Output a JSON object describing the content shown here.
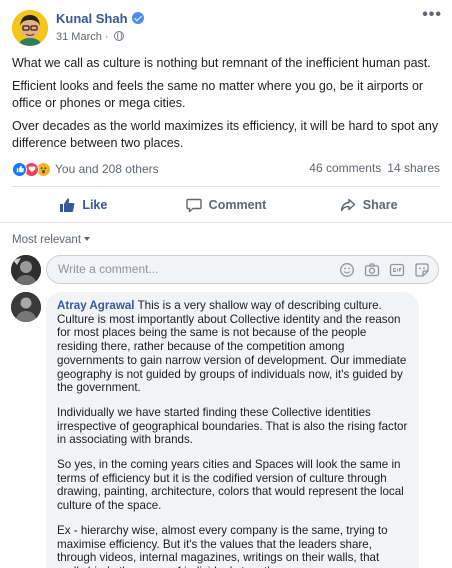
{
  "post": {
    "author": "Kunal Shah",
    "date": "31 March",
    "separator": "·",
    "more": "•••",
    "paragraphs": [
      "What we call as culture is nothing but remnant of the inefficient human past.",
      "Efficient looks and feels the same no matter where you go, be it airports or office or phones or mega cities.",
      "Over decades as the world maximizes its efficiency, it will be hard to spot any difference between two places."
    ],
    "reactions_text": "You and 208 others",
    "comments_count": "46 comments",
    "shares_count": "14 shares",
    "reaction_icons": [
      "like-icon",
      "love-icon",
      "wow-icon"
    ]
  },
  "actions": {
    "like": "Like",
    "comment": "Comment",
    "share": "Share"
  },
  "comments_filter": "Most relevant",
  "comment_input": {
    "placeholder": "Write a comment...",
    "icons": [
      "emoji-icon",
      "camera-icon",
      "gif-icon",
      "sticker-icon"
    ]
  },
  "comment": {
    "author": "Atray Agrawal",
    "paragraphs": [
      "This is a very shallow way of describing culture. Culture is most importantly about Collective identity and the reason for most places being the same is not because of the people residing there, rather because of the competition among governments to gain narrow version of development. Our immediate geography is not guided by groups of individuals now, it's guided by the government.",
      "Individually we have started finding these Collective identities irrespective of geographical boundaries. That is also the rising factor in associating with brands.",
      "So yes, in the coming years cities and Spaces will look the same in terms of efficiency but it is the codified version of culture through drawing, painting, architecture, colors that would represent the local culture of the space.",
      "Ex - hierarchy wise, almost every company is the same, trying to maximise efficiency. But it's the values that the leaders share, through videos, internal magazines, writings on their walls, that really binds the group of individuals together."
    ]
  },
  "colors": {
    "link": "#385898",
    "like_blue": "#1877f2",
    "love_red": "#f33e58",
    "wow_yellow": "#f7b125",
    "bubble_bg": "#f2f3f5"
  }
}
